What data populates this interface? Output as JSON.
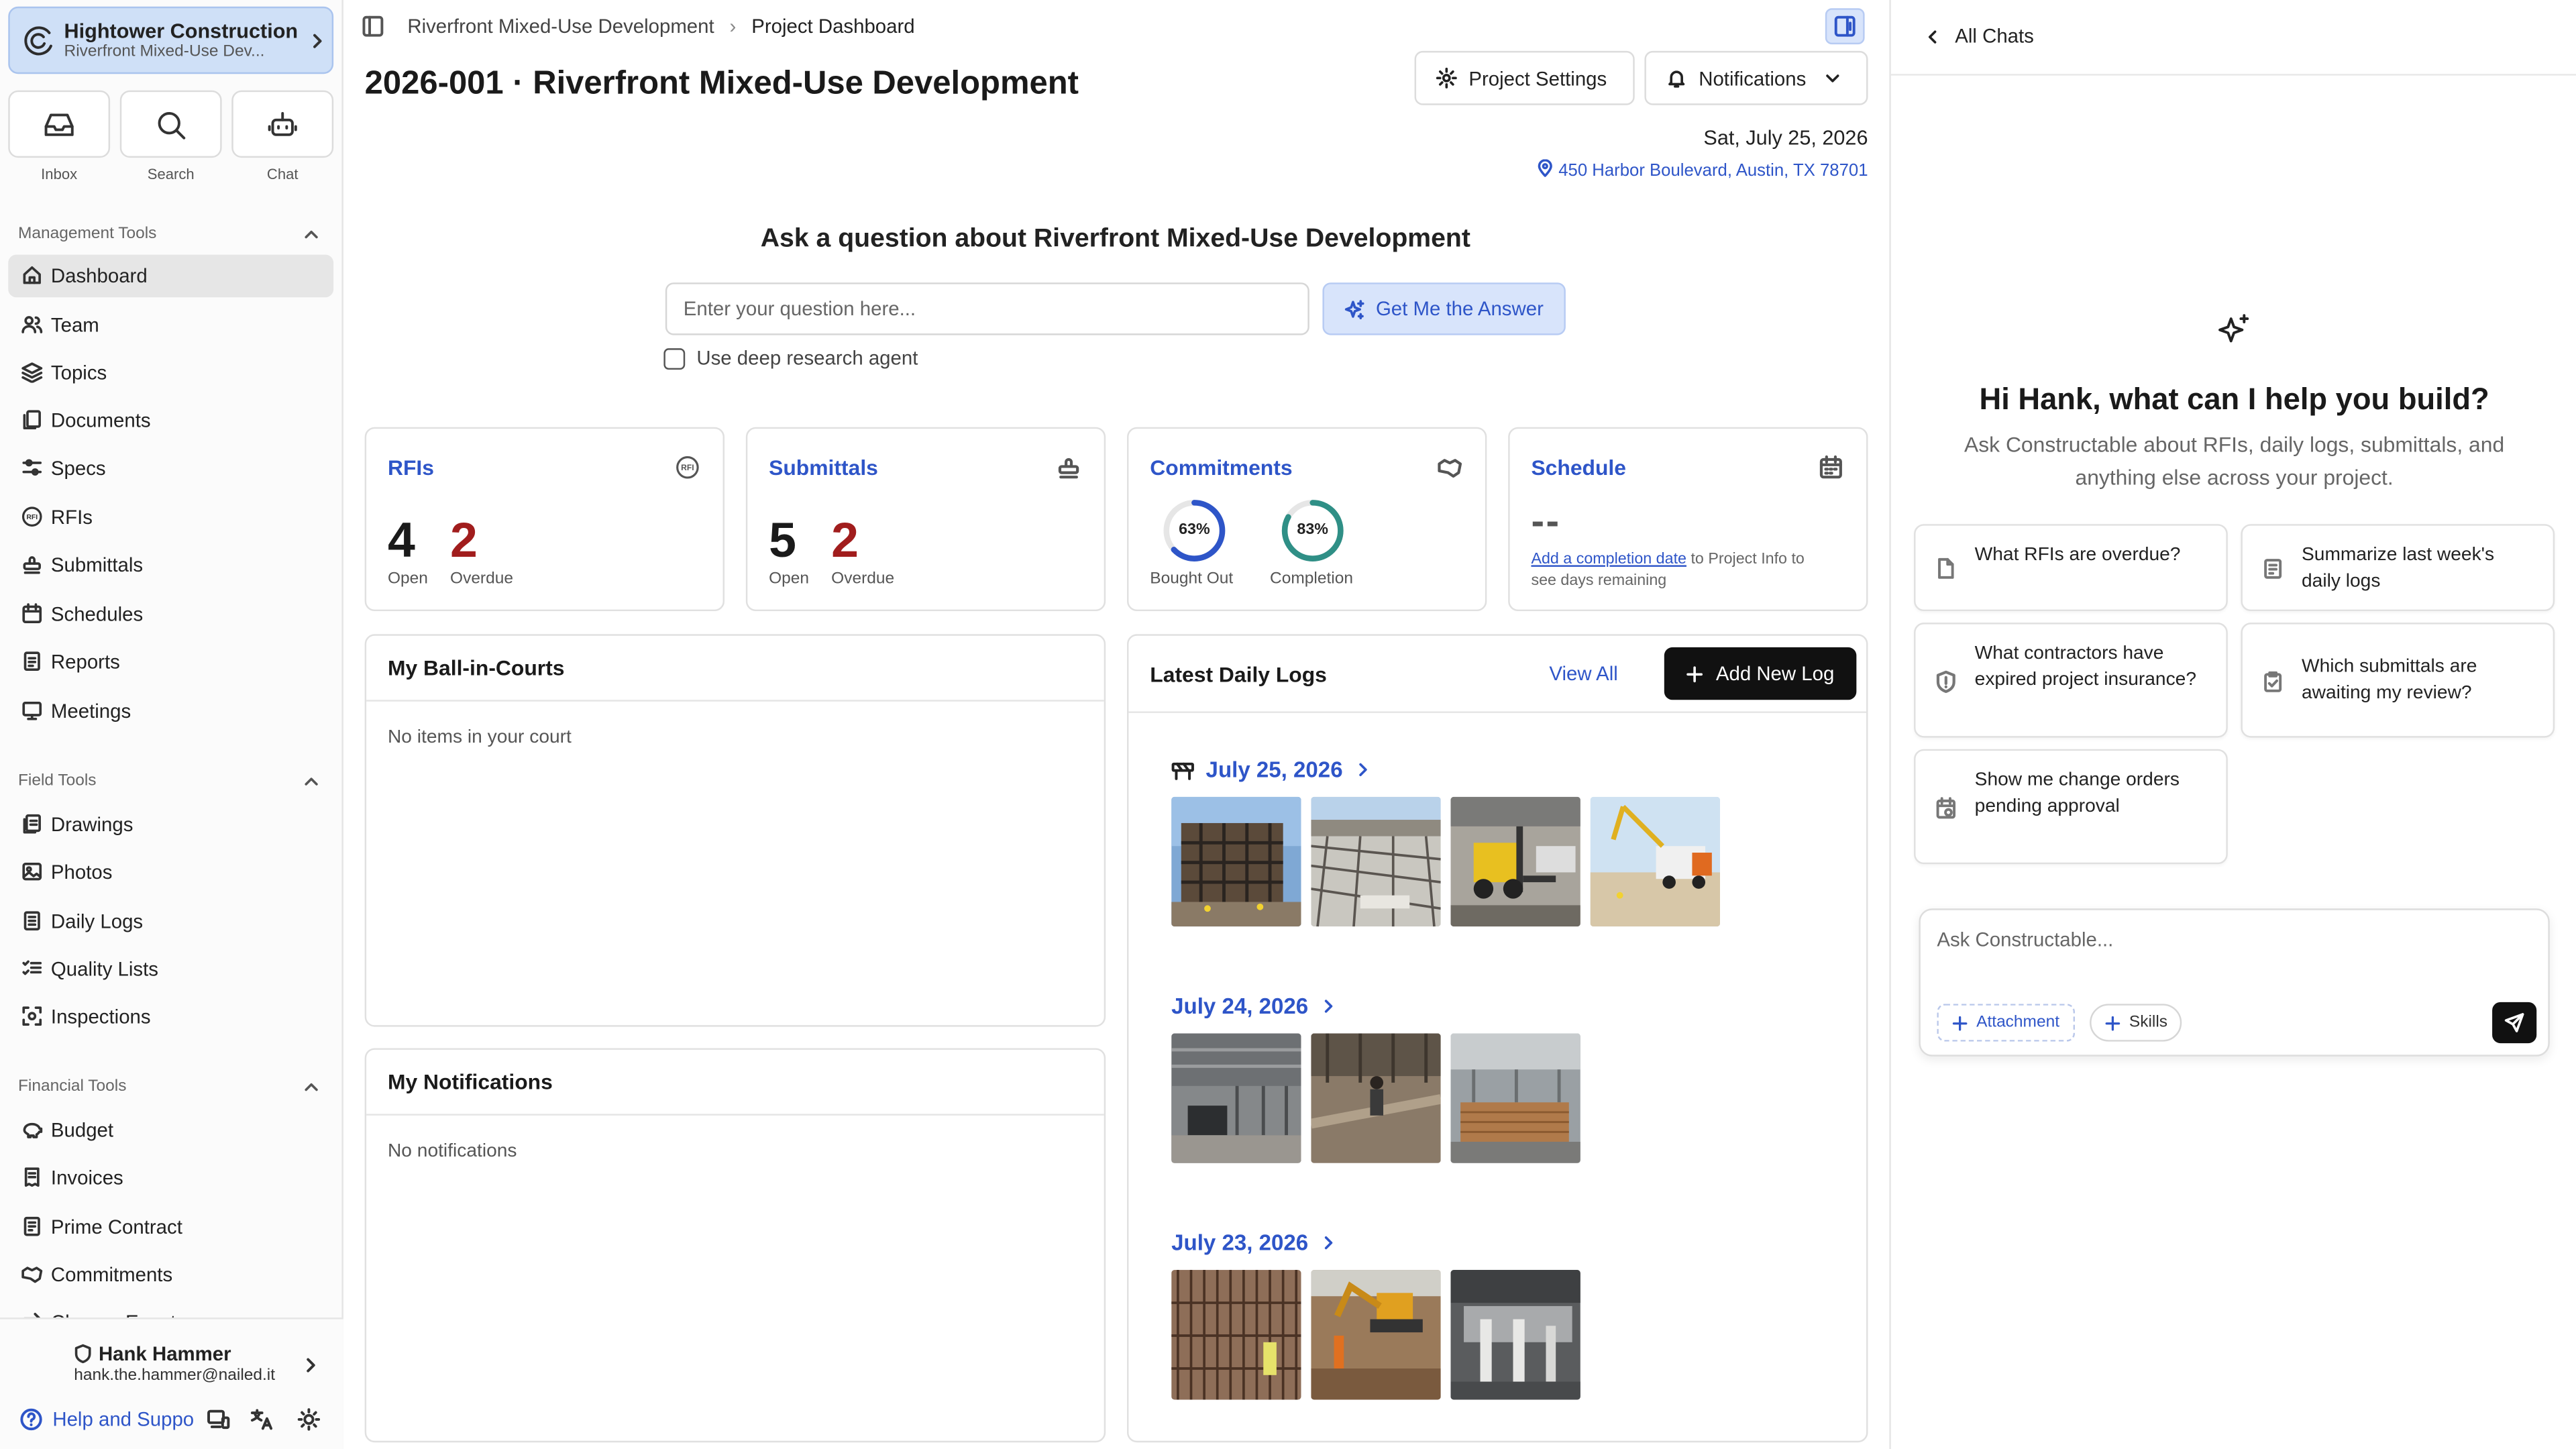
{
  "org": {
    "name": "Hightower Construction",
    "project_short": "Riverfront Mixed-Use Dev..."
  },
  "quick": {
    "inbox": "Inbox",
    "search": "Search",
    "chat": "Chat"
  },
  "sidebar": {
    "management_title": "Management Tools",
    "management": [
      "Dashboard",
      "Team",
      "Topics",
      "Documents",
      "Specs",
      "RFIs",
      "Submittals",
      "Schedules",
      "Reports",
      "Meetings"
    ],
    "field_title": "Field Tools",
    "field": [
      "Drawings",
      "Photos",
      "Daily Logs",
      "Quality Lists",
      "Inspections"
    ],
    "financial_title": "Financial Tools",
    "financial": [
      "Budget",
      "Invoices",
      "Prime Contract",
      "Commitments",
      "Change Events"
    ]
  },
  "user": {
    "name": "Hank Hammer",
    "email": "hank.the.hammer@nailed.it",
    "help": "Help and Suppo"
  },
  "breadcrumb": {
    "project": "Riverfront Mixed-Use Development",
    "current": "Project Dashboard"
  },
  "page_title": "2026-001 · Riverfront Mixed-Use Development",
  "buttons": {
    "settings": "Project Settings",
    "notifications": "Notifications",
    "answer": "Get Me the Answer",
    "view_all": "View All",
    "add_log": "Add New Log"
  },
  "date": "Sat, July 25, 2026",
  "address": "450 Harbor Boulevard, Austin, TX 78701",
  "ask": {
    "title": "Ask a question about Riverfront Mixed-Use Development",
    "placeholder": "Enter your question here...",
    "deep": "Use deep research agent"
  },
  "cards": {
    "rfis": {
      "title": "RFIs",
      "open": "4",
      "overdue": "2",
      "open_label": "Open",
      "overdue_label": "Overdue"
    },
    "submittals": {
      "title": "Submittals",
      "open": "5",
      "overdue": "2",
      "open_label": "Open",
      "overdue_label": "Overdue"
    },
    "commitments": {
      "title": "Commitments",
      "bought_out": "63%",
      "bought_out_label": "Bought Out",
      "completion": "83%",
      "completion_label": "Completion",
      "bought_out_frac": 0.63,
      "completion_frac": 0.83
    },
    "schedule": {
      "title": "Schedule",
      "value": "--",
      "link": "Add a completion date",
      "rest1": " to Project Info to",
      "rest2": "see days remaining"
    }
  },
  "ballcourt": {
    "title": "My Ball-in-Courts",
    "empty": "No items in your court"
  },
  "notifications": {
    "title": "My Notifications",
    "empty": "No notifications"
  },
  "daily_logs": {
    "title": "Latest Daily Logs",
    "entries": [
      {
        "date": "July 25, 2026",
        "photos": [
          "steel-frame",
          "rebar-deck",
          "forklift",
          "concrete-pump"
        ]
      },
      {
        "date": "July 24, 2026",
        "photos": [
          "interior-framing",
          "worker-floor",
          "lumber-stack"
        ]
      },
      {
        "date": "July 23, 2026",
        "photos": [
          "rebar-wall",
          "excavator",
          "interior-columns"
        ]
      }
    ]
  },
  "chat": {
    "back": "All Chats",
    "greeting": "Hi Hank, what can I help you build?",
    "sub": "Ask Constructable about RFIs, daily logs, submittals, and anything else across your project.",
    "suggestions": [
      "What RFIs are overdue?",
      "Summarize last week's daily logs",
      "What contractors have expired project insurance?",
      "Which submittals are awaiting my review?",
      "Show me change orders pending approval"
    ],
    "placeholder": "Ask Constructable...",
    "attachment": "Attachment",
    "skills": "Skills"
  },
  "colors": {
    "accent": "#2e55c8",
    "overdue": "#a11d1d",
    "ring_blue": "#2e55c8",
    "ring_teal": "#2f8f86"
  }
}
